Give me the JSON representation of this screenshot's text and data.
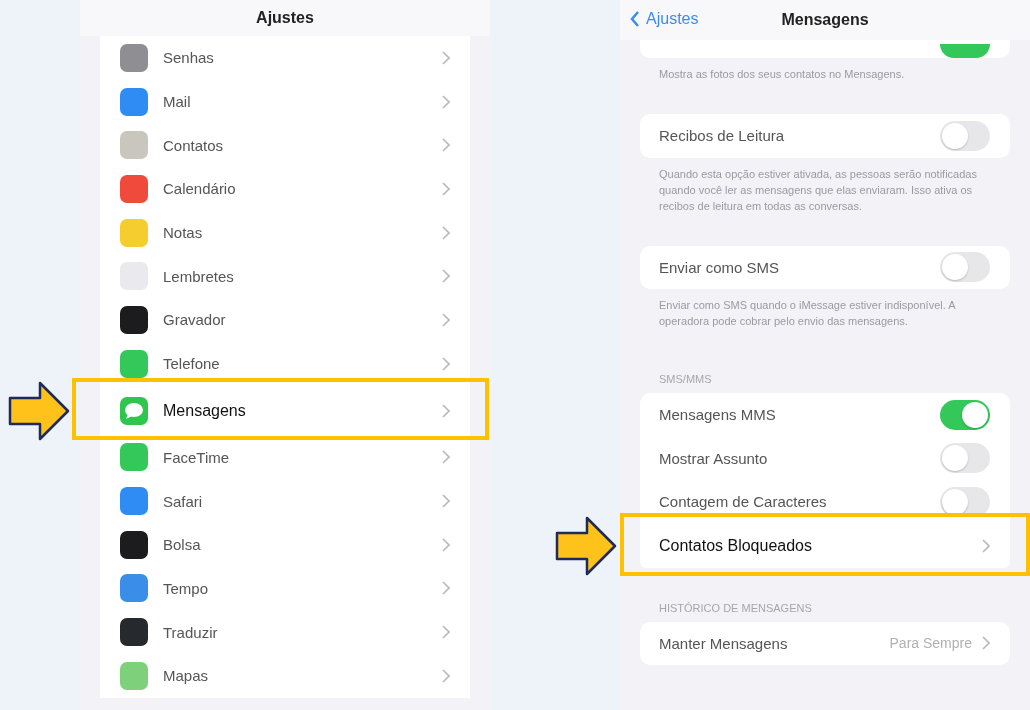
{
  "settings_list": {
    "title": "Ajustes",
    "items": [
      {
        "label": "Senhas",
        "color": "#8e8e93",
        "kind": "plain",
        "highlighted": false
      },
      {
        "label": "Mail",
        "color": "#2f8cf5",
        "kind": "plain",
        "highlighted": false
      },
      {
        "label": "Contatos",
        "color": "#c9c6bd",
        "kind": "plain",
        "highlighted": false
      },
      {
        "label": "Calendário",
        "color": "#f04a3c",
        "kind": "plain",
        "highlighted": false
      },
      {
        "label": "Notas",
        "color": "#f5cd2e",
        "kind": "plain",
        "highlighted": false
      },
      {
        "label": "Lembretes",
        "color": "#e9e9ee",
        "kind": "plain",
        "highlighted": false
      },
      {
        "label": "Gravador",
        "color": "#1c1c1e",
        "kind": "plain",
        "highlighted": false
      },
      {
        "label": "Telefone",
        "color": "#34c759",
        "kind": "plain",
        "highlighted": false
      },
      {
        "label": "Mensagens",
        "color": "#2fc64f",
        "kind": "bubble",
        "highlighted": true
      },
      {
        "label": "FaceTime",
        "color": "#34c759",
        "kind": "plain",
        "highlighted": false
      },
      {
        "label": "Safari",
        "color": "#2f8cf5",
        "kind": "plain",
        "highlighted": false
      },
      {
        "label": "Bolsa",
        "color": "#1c1c1e",
        "kind": "plain",
        "highlighted": false
      },
      {
        "label": "Tempo",
        "color": "#3a8ee8",
        "kind": "plain",
        "highlighted": false
      },
      {
        "label": "Traduzir",
        "color": "#26292e",
        "kind": "plain",
        "highlighted": false
      },
      {
        "label": "Mapas",
        "color": "#7fd07a",
        "kind": "plain",
        "highlighted": false
      }
    ]
  },
  "messages_settings": {
    "back": "Ajustes",
    "title": "Mensagens",
    "sections": [
      {
        "rows": [
          {
            "kind": "toggle",
            "on": true,
            "highlighted": false
          }
        ],
        "footer": "Mostra as fotos dos seus contatos no Mensagens."
      },
      {
        "rows": [
          {
            "kind": "toggle",
            "label": "Recibos de Leitura",
            "on": false,
            "highlighted": false
          }
        ],
        "footer": "Quando esta opção estiver ativada, as pessoas serão notificadas quando você ler as mensagens que elas enviaram. Isso ativa os recibos de leitura em todas as conversas."
      },
      {
        "rows": [
          {
            "kind": "toggle",
            "label": "Enviar como SMS",
            "on": false,
            "highlighted": false
          }
        ],
        "footer": "Enviar como SMS quando o iMessage estiver indisponível. A operadora pode cobrar pelo envio das mensagens."
      },
      {
        "header": "SMS/MMS",
        "rows": [
          {
            "kind": "toggle",
            "label": "Mensagens MMS",
            "on": true,
            "highlighted": false
          },
          {
            "kind": "toggle",
            "label": "Mostrar Assunto",
            "on": false,
            "highlighted": false
          },
          {
            "kind": "toggle",
            "label": "Contagem de Caracteres",
            "on": false,
            "highlighted": false
          },
          {
            "kind": "link",
            "label": "Contatos Bloqueados",
            "highlighted": true
          }
        ]
      },
      {
        "header": "HISTÓRICO DE MENSAGENS",
        "rows": [
          {
            "kind": "link",
            "label": "Manter Mensagens",
            "value": "Para Sempre",
            "highlighted": false
          }
        ]
      }
    ]
  }
}
